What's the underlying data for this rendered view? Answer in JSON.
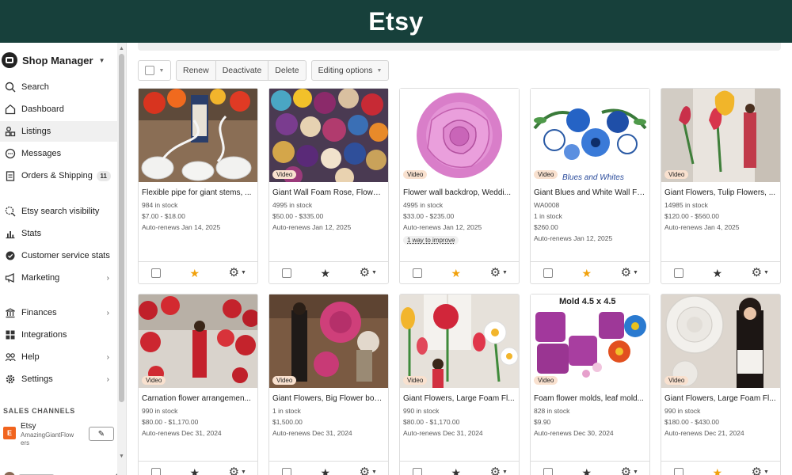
{
  "banner": {
    "title": "Etsy"
  },
  "sidebar": {
    "shop_title": "Shop Manager",
    "items": [
      {
        "label": "Search"
      },
      {
        "label": "Dashboard"
      },
      {
        "label": "Listings"
      },
      {
        "label": "Messages"
      },
      {
        "label": "Orders & Shipping",
        "badge": "11"
      },
      {
        "label": "Etsy search visibility"
      },
      {
        "label": "Stats"
      },
      {
        "label": "Customer service stats"
      },
      {
        "label": "Marketing"
      },
      {
        "label": "Finances"
      },
      {
        "label": "Integrations"
      },
      {
        "label": "Help"
      },
      {
        "label": "Settings"
      }
    ],
    "sales_channels_label": "SALES CHANNELS",
    "channel": {
      "name": "Etsy",
      "shop": "AmazingGiantFlowers",
      "badge": "E"
    }
  },
  "toolbar": {
    "renew": "Renew",
    "deactivate": "Deactivate",
    "delete": "Delete",
    "editing": "Editing options"
  },
  "listings": [
    {
      "title": "Flexible pipe for giant stems, ...",
      "stock": "984 in stock",
      "price": "$7.00 - $18.00",
      "renews": "Auto-renews Jan 14, 2025"
    },
    {
      "title": "Giant Wall Foam Rose, Flower ...",
      "stock": "4995 in stock",
      "price": "$50.00 - $335.00",
      "renews": "Auto-renews Jan 12, 2025",
      "video": "Video"
    },
    {
      "title": "Flower wall backdrop, Weddi...",
      "stock": "4995 in stock",
      "price": "$33.00 - $235.00",
      "renews": "Auto-renews Jan 12, 2025",
      "video": "Video",
      "improve": "1 way to improve"
    },
    {
      "title": "Giant Blues and White Wall Fo...",
      "sku": "WA0008",
      "stock": "1 in stock",
      "price": "$260.00",
      "renews": "Auto-renews Jan 12, 2025",
      "video": "Video",
      "overlay": "Blues and Whites"
    },
    {
      "title": "Giant Flowers, Tulip Flowers, ...",
      "stock": "14985 in stock",
      "price": "$120.00 - $560.00",
      "renews": "Auto-renews Jan 4, 2025",
      "video": "Video"
    },
    {
      "title": "Carnation flower arrangemen...",
      "stock": "990 in stock",
      "price": "$80.00 - $1,170.00",
      "renews": "Auto-renews Dec 31, 2024",
      "video": "Video"
    },
    {
      "title": "Giant Flowers, Big Flower bou...",
      "stock": "1 in stock",
      "price": "$1,500.00",
      "renews": "Auto-renews Dec 31, 2024",
      "video": "Video"
    },
    {
      "title": "Giant Flowers, Large Foam Fl...",
      "stock": "990 in stock",
      "price": "$80.00 - $1,170.00",
      "renews": "Auto-renews Dec 31, 2024",
      "video": "Video"
    },
    {
      "title": "Foam flower molds, leaf mold...",
      "stock": "828 in stock",
      "price": "$9.90",
      "renews": "Auto-renews Dec 30, 2024",
      "video": "Video",
      "overlay": "Mold 4.5 x 4.5"
    },
    {
      "title": "Giant Flowers, Large Foam Fl...",
      "stock": "990 in stock",
      "price": "$180.00 - $430.00",
      "renews": "Auto-renews Dec 21, 2024",
      "video": "Video"
    }
  ],
  "stars": [
    "featured",
    "not-featured",
    "featured",
    "featured",
    "not-featured",
    "not-featured",
    "not-featured",
    "not-featured",
    "not-featured",
    "featured"
  ],
  "colors": {
    "banner_bg": "#17403b",
    "star_featured": "#f1a10c",
    "star_plain": "#333333",
    "video_badge": "#f9e1cf",
    "etsy_orange": "#f1641e"
  }
}
